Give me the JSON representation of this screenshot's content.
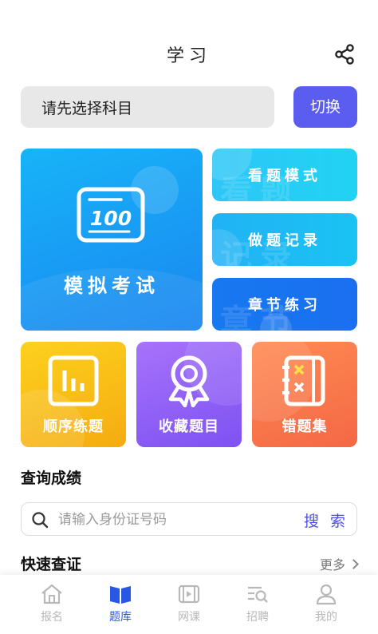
{
  "header": {
    "title": "学习",
    "share_icon": "share-icon"
  },
  "subject": {
    "placeholder_text": "请先选择科目",
    "switch_label": "切换"
  },
  "main_card": {
    "label": "模拟考试",
    "badge_text": "100",
    "icon": "score-board-icon"
  },
  "side_cards": [
    {
      "label": "看题模式",
      "ghost": "看题"
    },
    {
      "label": "做题记录",
      "ghost": "记录"
    },
    {
      "label": "章节练习",
      "ghost": "章节"
    }
  ],
  "tiles": [
    {
      "label": "顺序练题",
      "icon": "bar-chart-icon"
    },
    {
      "label": "收藏题目",
      "icon": "ribbon-badge-icon"
    },
    {
      "label": "错题集",
      "icon": "wrong-notebook-icon"
    }
  ],
  "query": {
    "title": "查询成绩",
    "placeholder": "请输入身份证号码",
    "search_label": "搜 索"
  },
  "quick": {
    "title": "快速查证",
    "more_label": "更多"
  },
  "tabbar": {
    "items": [
      {
        "label": "报名",
        "icon": "home-icon",
        "active": false
      },
      {
        "label": "题库",
        "icon": "book-icon",
        "active": true
      },
      {
        "label": "网课",
        "icon": "video-icon",
        "active": false
      },
      {
        "label": "招聘",
        "icon": "job-search-icon",
        "active": false
      },
      {
        "label": "我的",
        "icon": "user-icon",
        "active": false
      }
    ]
  },
  "colors": {
    "accent": "#5b5cf0",
    "tab_active": "#2a56e6",
    "tab_inactive": "#b8b8b8",
    "blue_card": "#1a86f0",
    "yellow_tile": "#f6ab10",
    "purple_tile": "#7e52f2",
    "orange_tile": "#f46845"
  }
}
